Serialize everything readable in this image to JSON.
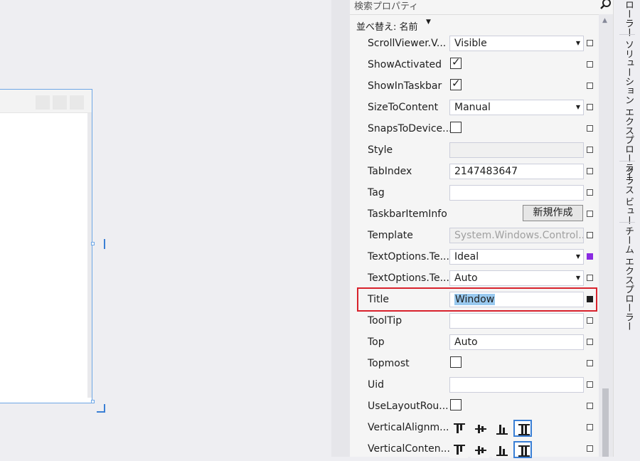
{
  "search": {
    "placeholder": "検索プロパティ"
  },
  "sort": {
    "label": "並べ替え: 名前"
  },
  "properties": [
    {
      "name": "ScrollViewer.V...",
      "type": "dropdown",
      "value": "Visible"
    },
    {
      "name": "ShowActivated",
      "type": "checkbox",
      "checked": true
    },
    {
      "name": "ShowInTaskbar",
      "type": "checkbox",
      "checked": true
    },
    {
      "name": "SizeToContent",
      "type": "dropdown",
      "value": "Manual"
    },
    {
      "name": "SnapsToDevice...",
      "type": "checkbox",
      "checked": false
    },
    {
      "name": "Style",
      "type": "disabled",
      "value": ""
    },
    {
      "name": "TabIndex",
      "type": "text",
      "value": "2147483647"
    },
    {
      "name": "Tag",
      "type": "text",
      "value": ""
    },
    {
      "name": "TaskbarItemInfo",
      "type": "button",
      "value": "新規作成"
    },
    {
      "name": "Template",
      "type": "disabled",
      "value": "System.Windows.Control..."
    },
    {
      "name": "TextOptions.Te...",
      "type": "dropdown",
      "value": "Ideal",
      "marker": "purple"
    },
    {
      "name": "TextOptions.Te...",
      "type": "dropdown",
      "value": "Auto"
    },
    {
      "name": "Title",
      "type": "text-selected",
      "value": "Window",
      "marker": "filled"
    },
    {
      "name": "ToolTip",
      "type": "text",
      "value": ""
    },
    {
      "name": "Top",
      "type": "text",
      "value": "Auto"
    },
    {
      "name": "Topmost",
      "type": "checkbox",
      "checked": false
    },
    {
      "name": "Uid",
      "type": "text",
      "value": ""
    },
    {
      "name": "UseLayoutRou...",
      "type": "checkbox",
      "checked": false
    },
    {
      "name": "VerticalAlignm...",
      "type": "align"
    },
    {
      "name": "VerticalConten...",
      "type": "align"
    }
  ],
  "dock_tabs": [
    "ローラー",
    "ソリューション エクスプローラー",
    "クラス ビュー",
    "チーム エクスプローラー"
  ],
  "colors": {
    "accent": "#3a7fd5",
    "highlight": "#d8222c",
    "selection": "#99c9ef"
  }
}
